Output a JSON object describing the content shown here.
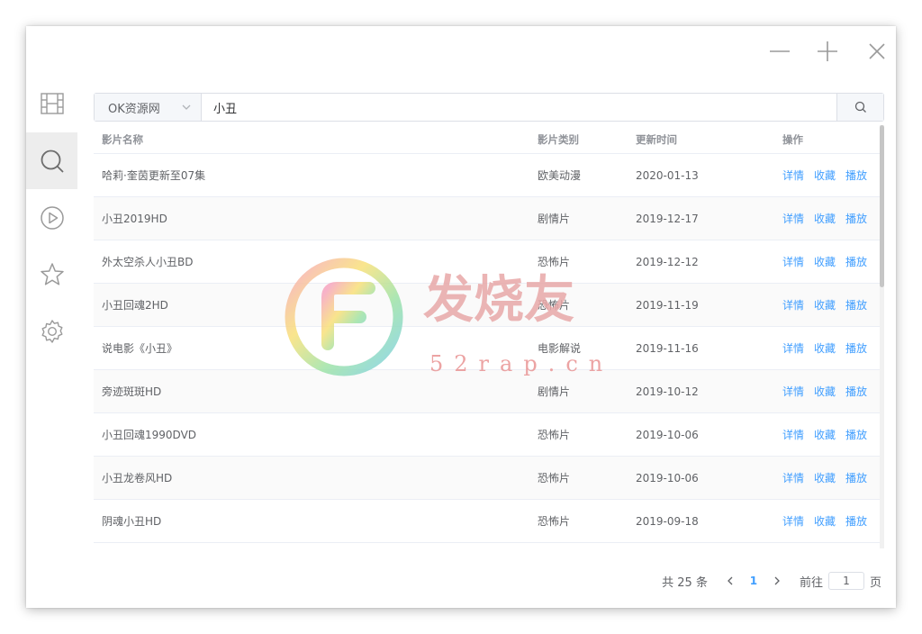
{
  "window_controls": {
    "minimize_icon": "minimize-icon",
    "maximize_icon": "plus-icon",
    "close_icon": "close-icon"
  },
  "sidebar": {
    "items": [
      {
        "icon": "film-icon",
        "active": false
      },
      {
        "icon": "search-icon",
        "active": true
      },
      {
        "icon": "play-circle-icon",
        "active": false
      },
      {
        "icon": "star-icon",
        "active": false
      },
      {
        "icon": "gear-icon",
        "active": false
      }
    ]
  },
  "search": {
    "source_selected": "OK资源网",
    "query": "小丑",
    "button_icon": "search-icon"
  },
  "table": {
    "headers": {
      "name": "影片名称",
      "type": "影片类别",
      "time": "更新时间",
      "ops": "操作"
    },
    "op_labels": {
      "detail": "详情",
      "favorite": "收藏",
      "play": "播放"
    },
    "rows": [
      {
        "name": "哈莉·奎茵更新至07集",
        "type": "欧美动漫",
        "time": "2020-01-13"
      },
      {
        "name": "小丑2019HD",
        "type": "剧情片",
        "time": "2019-12-17"
      },
      {
        "name": "外太空杀人小丑BD",
        "type": "恐怖片",
        "time": "2019-12-12"
      },
      {
        "name": "小丑回魂2HD",
        "type": "恐怖片",
        "time": "2019-11-19"
      },
      {
        "name": "说电影《小丑》",
        "type": "电影解说",
        "time": "2019-11-16"
      },
      {
        "name": "旁迹斑斑HD",
        "type": "剧情片",
        "time": "2019-10-12"
      },
      {
        "name": "小丑回魂1990DVD",
        "type": "恐怖片",
        "time": "2019-10-06"
      },
      {
        "name": "小丑龙卷风HD",
        "type": "恐怖片",
        "time": "2019-10-06"
      },
      {
        "name": "阴魂小丑HD",
        "type": "恐怖片",
        "time": "2019-09-18"
      }
    ]
  },
  "pagination": {
    "total_text": "共 25 条",
    "current_page": "1",
    "goto_label": "前往",
    "goto_value": "1",
    "page_suffix": "页"
  },
  "watermark": {
    "brand": "发烧友",
    "domain": "52rap.cn"
  },
  "colors": {
    "accent": "#409eff",
    "border": "#dcdfe6",
    "text": "#606266",
    "header_text": "#909399",
    "active_sidebar": "#ededed"
  }
}
